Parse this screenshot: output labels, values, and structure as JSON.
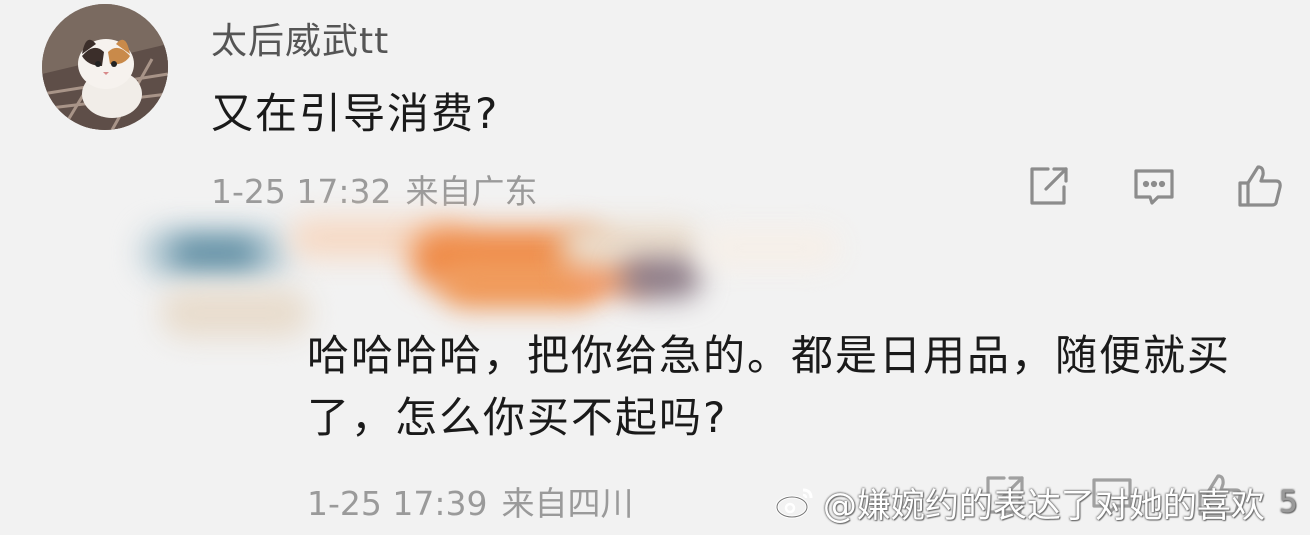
{
  "comment": {
    "username": "太后威武tt",
    "text": "又在引导消费?",
    "time": "1-25 17:32",
    "location": "来自广东",
    "icons": [
      "share-icon",
      "reply-icon",
      "like-icon"
    ]
  },
  "reply": {
    "text": "哈哈哈哈，把你给急的。都是日用品，随便就买了，怎么你买不起吗?",
    "time": "1-25 17:39",
    "location": "来自四川",
    "like_count": "5",
    "icons": [
      "share-icon",
      "reply-icon",
      "like-icon"
    ]
  },
  "watermark": {
    "text": "@嫌婉约的表达了对她的喜欢"
  },
  "colors": {
    "background": "#f2f2f2",
    "text_primary": "#1a1a1a",
    "text_secondary": "#9a9a9a",
    "username": "#555555"
  }
}
